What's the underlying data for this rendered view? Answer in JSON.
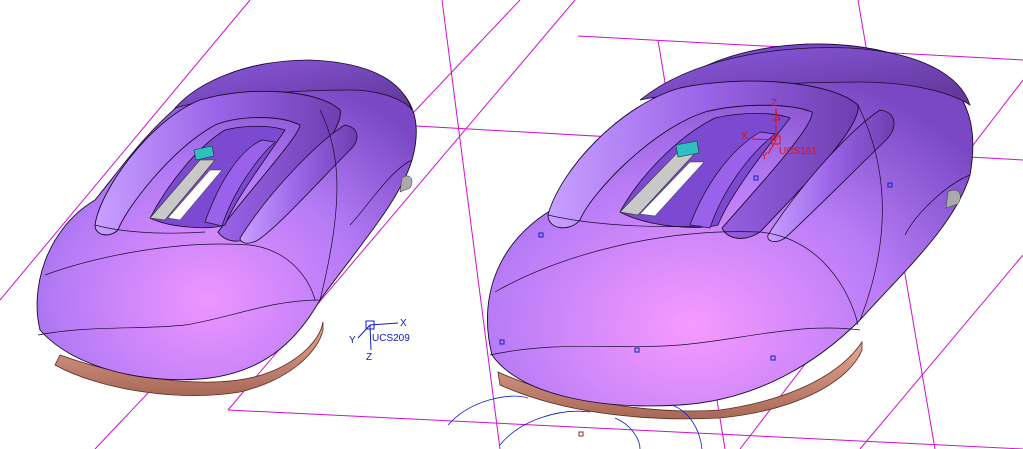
{
  "viewport": {
    "background": "#ffffff",
    "colors": {
      "model_body": "#a070f0",
      "model_highlight": "#e890ff",
      "model_shadow": "#6a3fa8",
      "base_plate": "#d99080",
      "accent_cyan": "#2fbfbf",
      "gray_parts": "#c8c8c8",
      "datum_planes": "#d010d0",
      "ucs_blue": "#1020c0",
      "ucs_red": "#e01010"
    }
  },
  "left_model": {
    "ucs": {
      "name": "UCS209",
      "x_axis": "X",
      "y_axis": "Y",
      "z_axis": "Z"
    }
  },
  "right_model": {
    "ucs": {
      "name": "UCS161",
      "x_axis": "X",
      "y_axis": "Y",
      "z_axis": "Z"
    }
  }
}
